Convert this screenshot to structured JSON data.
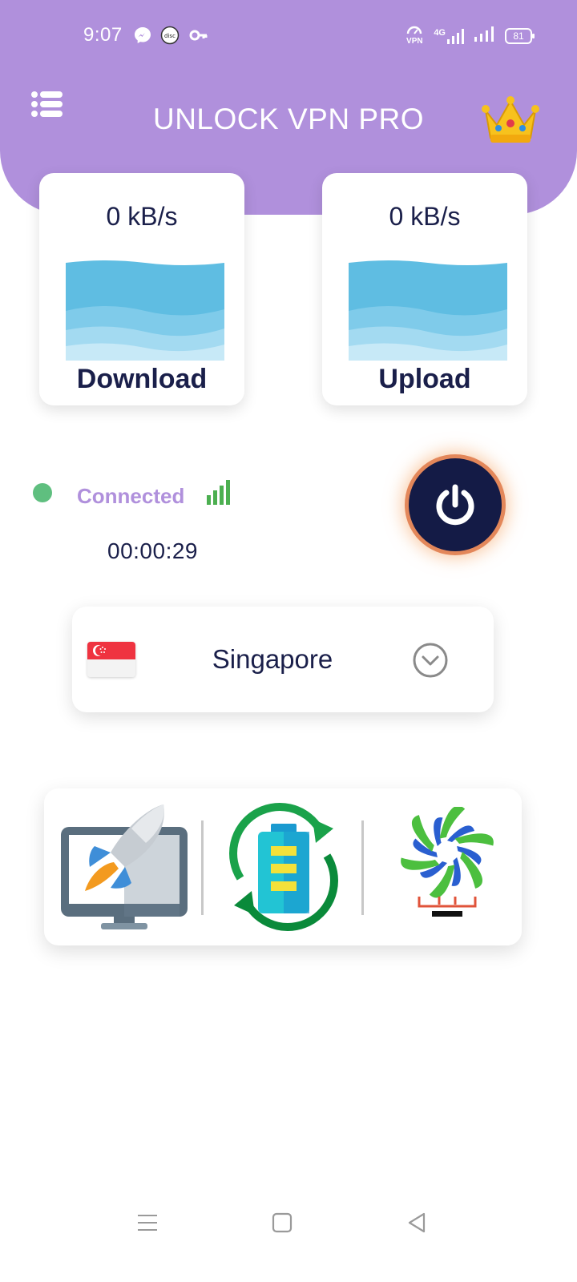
{
  "status_bar": {
    "time": "9:07",
    "icons": [
      "messenger-icon",
      "disc-icon",
      "key-icon",
      "vpn-icon",
      "signal-4g-icon",
      "signal-icon",
      "battery-icon"
    ],
    "vpn_label": "VPN",
    "network_type": "4G",
    "battery_level": "81"
  },
  "header": {
    "title": "UNLOCK VPN PRO",
    "menu_icon": "list-menu-icon",
    "premium_icon": "crown-icon"
  },
  "speed": {
    "download": {
      "value": "0 kB/s",
      "label": "Download"
    },
    "upload": {
      "value": "0 kB/s",
      "label": "Upload"
    }
  },
  "connection": {
    "status": "Connected",
    "duration": "00:00:29",
    "status_color": "#5fbf7f"
  },
  "server": {
    "country": "Singapore",
    "flag_icon": "singapore-flag-icon"
  },
  "tools": [
    {
      "name": "speed-booster",
      "icon": "rocket-monitor-icon"
    },
    {
      "name": "battery-saver",
      "icon": "battery-refresh-icon"
    },
    {
      "name": "cpu-cooler",
      "icon": "cooler-fan-icon"
    }
  ],
  "colors": {
    "accent": "#b090dc",
    "dark": "#141b46",
    "power_glow": "#e3875a",
    "wave": "#5fbde2"
  }
}
